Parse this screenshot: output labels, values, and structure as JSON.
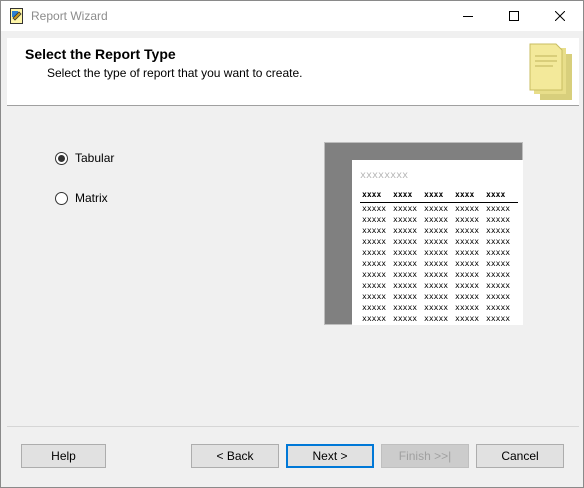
{
  "window": {
    "title": "Report Wizard"
  },
  "header": {
    "title": "Select the Report Type",
    "subtitle": "Select the type of report that you want to create."
  },
  "report_types": [
    {
      "label": "Tabular",
      "selected": true
    },
    {
      "label": "Matrix",
      "selected": false
    }
  ],
  "preview": {
    "title_placeholder": "xxxxxxxx",
    "columns": [
      "xxxx",
      "xxxx",
      "xxxx",
      "xxxx",
      "xxxx"
    ],
    "cell_text": "xxxxx",
    "row_count": 11
  },
  "buttons": {
    "help": "Help",
    "back": "< Back",
    "next": "Next >",
    "finish": "Finish >>|",
    "cancel": "Cancel"
  },
  "colors": {
    "accent": "#0078d7",
    "preview_background": "#808080",
    "header_icon": "#f3e99a"
  },
  "icons": {
    "app": "report-wizard-icon",
    "header": "report-document-icon"
  }
}
